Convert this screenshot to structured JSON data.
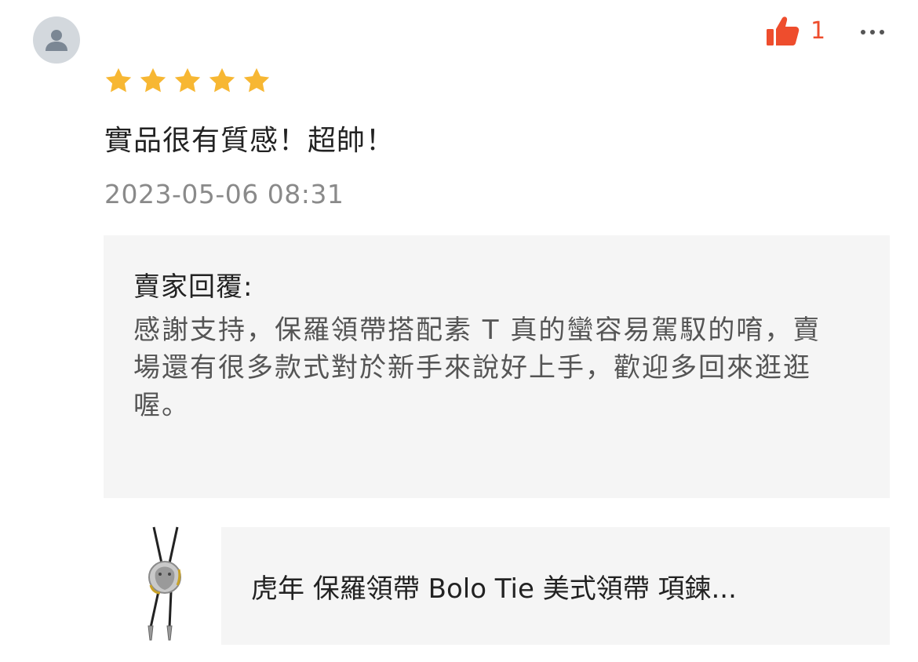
{
  "review": {
    "avatar_icon": "user-avatar-icon",
    "rating": 5,
    "rating_max": 5,
    "text": "實品很有質感！超帥！",
    "date": "2023-05-06 08:31",
    "like_icon": "thumbs-up-icon",
    "like_count": "1",
    "more_icon": "more-dots-icon"
  },
  "seller_reply": {
    "title": "賣家回覆:",
    "body": "感謝支持，保羅領帶搭配素 T 真的蠻容易駕馭的唷，賣場還有很多款式對於新手來說好上手，歡迎多回來逛逛喔。"
  },
  "product": {
    "image_icon": "bolo-tie-image",
    "name": "虎年 保羅領帶 Bolo Tie 美式領帶 項鍊..."
  },
  "colors": {
    "accent": "#ee4d2d",
    "star": "#f7b733",
    "text_primary": "#222222",
    "text_secondary": "#8a8a8a",
    "panel_bg": "#f5f5f5"
  }
}
